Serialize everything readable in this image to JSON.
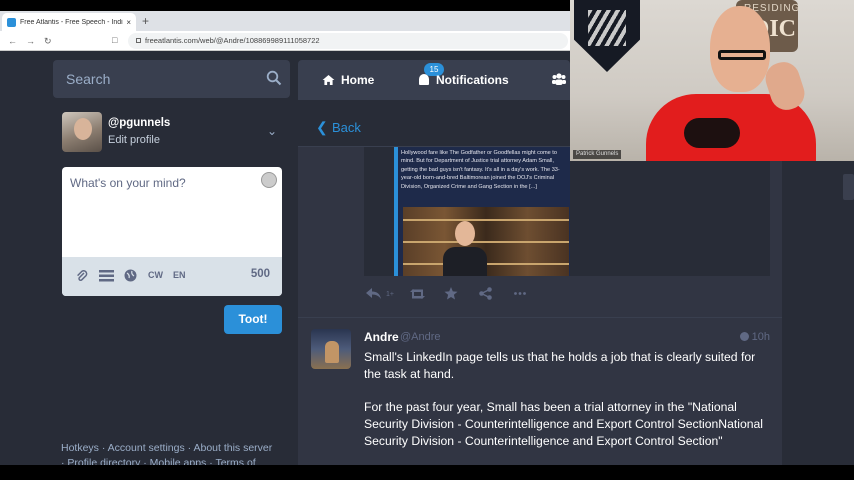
{
  "browser": {
    "tab_title": "Free Atlantis - Free Speech - Indie",
    "tab_close": "×",
    "new_tab": "+",
    "url": "freeatlantis.com/web/@Andre/108869989111058722"
  },
  "sidebar": {
    "search_placeholder": "Search",
    "account_handle": "@pgunnels",
    "edit_profile": "Edit profile",
    "compose": {
      "placeholder": "What's on your mind?",
      "cw": "CW",
      "lang": "EN",
      "char_count": "500"
    },
    "toot_label": "Toot!",
    "footer_line1": "Hotkeys · Account settings · About this server",
    "footer_line2": "· Profile directory · Mobile apps · Terms of"
  },
  "column": {
    "nav_home": "Home",
    "nav_notifications": "Notifications",
    "notifications_badge": "15",
    "back": "Back"
  },
  "card": {
    "text": "Hollywood fare like The Godfather or Goodfellas might come to mind. But for Department of Justice trial attorney Adam Small, getting the bad guys isn't fantasy. It's all in a day's work. The 33-year-old born-and-bred Baltimorean joined the DOJ's Criminal Division, Organized Crime and Gang Section in the [...]"
  },
  "actions": {
    "reply_count": "1+"
  },
  "status": {
    "display_name": "Andre",
    "acct": "@Andre",
    "time": "10h",
    "paragraph1": "Small's LinkedIn page tells us that he holds a job that is clearly suited for the task at hand.",
    "paragraph2": "For  the past four year, Small has been a trial attorney in the \"National Security Division - Counterintelligence and Export Control SectionNational Security Division - Counterintelligence and Export Control Section\""
  },
  "webcam": {
    "sign_text": "RESIDING",
    "sign_letters": "DIC",
    "label": "Patrick Gunnels"
  },
  "colors": {
    "accent": "#2b90d9",
    "background": "#282c37",
    "panel": "#393f4f"
  },
  "icons": [
    "search-icon",
    "chevron-down-icon",
    "emoji-icon",
    "paperclip-icon",
    "poll-icon",
    "globe-icon",
    "home-icon",
    "bell-icon",
    "people-icon",
    "chevron-left-icon",
    "reply-icon",
    "boost-icon",
    "star-icon",
    "share-icon",
    "ellipsis-icon"
  ]
}
